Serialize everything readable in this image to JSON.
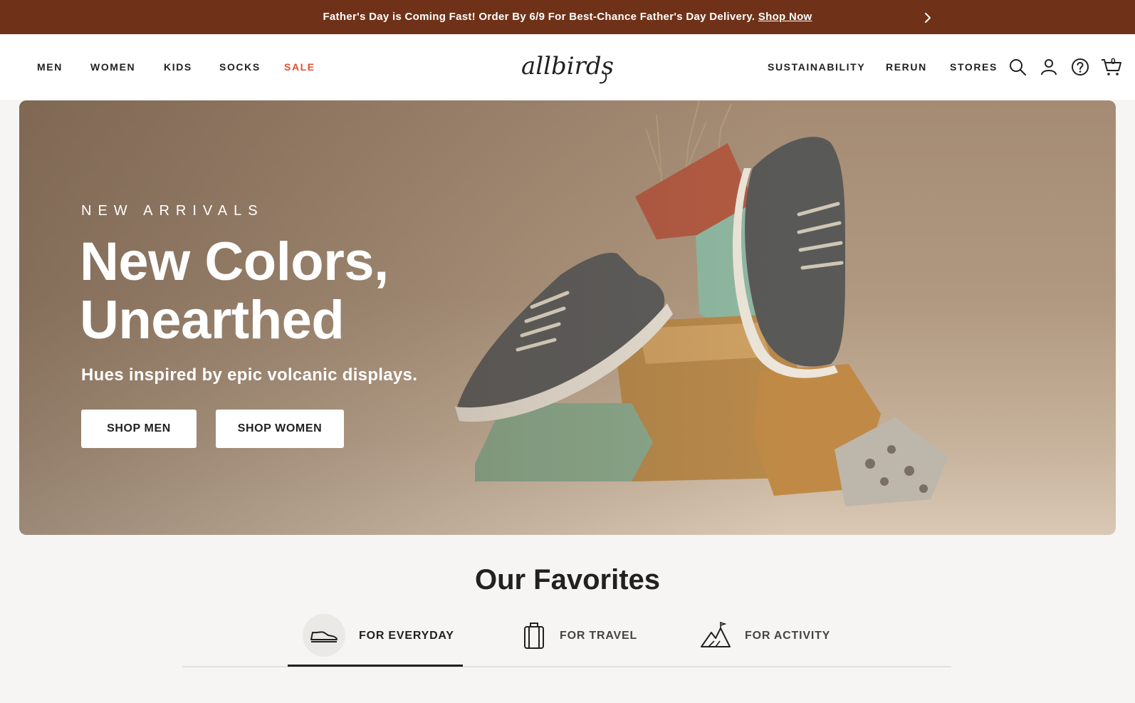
{
  "announcement": {
    "text": "Father's Day is Coming Fast! Order By 6/9 For Best-Chance Father's Day Delivery.",
    "link_label": "Shop Now",
    "next_icon": "chevron-right-icon"
  },
  "header": {
    "nav_left": [
      {
        "label": "MEN"
      },
      {
        "label": "WOMEN"
      },
      {
        "label": "KIDS"
      },
      {
        "label": "SOCKS"
      },
      {
        "label": "SALE",
        "accent": "#e04f2c"
      }
    ],
    "logo_text": "allbirds",
    "nav_right": [
      {
        "label": "SUSTAINABILITY"
      },
      {
        "label": "RERUN"
      },
      {
        "label": "STORES"
      }
    ],
    "icons": [
      "search-icon",
      "account-icon",
      "help-icon",
      "cart-icon"
    ],
    "cart_count": "0"
  },
  "hero": {
    "eyebrow": "NEW ARRIVALS",
    "headline_line1": "New Colors,",
    "headline_line2": "Unearthed",
    "subhead": "Hues inspired by epic volcanic displays.",
    "buttons": [
      {
        "label": "SHOP MEN"
      },
      {
        "label": "SHOP WOMEN"
      }
    ]
  },
  "favorites": {
    "title": "Our Favorites",
    "tabs": [
      {
        "label": "FOR EVERYDAY",
        "icon": "sneaker-icon",
        "selected": true
      },
      {
        "label": "FOR TRAVEL",
        "icon": "suitcase-icon",
        "selected": false
      },
      {
        "label": "FOR ACTIVITY",
        "icon": "mountain-icon",
        "selected": false
      }
    ]
  },
  "colors": {
    "announcement_bg": "#6f3218",
    "sale_accent": "#e04f2c",
    "page_bg": "#f6f5f3",
    "text": "#212121"
  }
}
